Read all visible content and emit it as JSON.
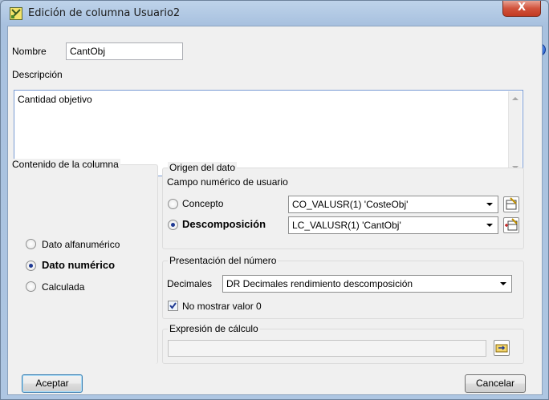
{
  "window": {
    "title": "Edición de columna Usuario2",
    "close_glyph": "X"
  },
  "nombre": {
    "label": "Nombre",
    "value": "CantObj"
  },
  "descripcion": {
    "label": "Descripción",
    "value": "Cantidad objetivo"
  },
  "help_glyph": "?",
  "contenido": {
    "title": "Contenido de la columna",
    "options": [
      {
        "label": "Dato alfanumérico",
        "selected": false
      },
      {
        "label": "Dato numérico",
        "selected": true
      },
      {
        "label": "Calculada",
        "selected": false
      }
    ]
  },
  "origen": {
    "title": "Origen del dato",
    "subtitle": "Campo numérico de usuario",
    "concepto": {
      "label": "Concepto",
      "selected": false,
      "value": "CO_VALUSR(1) 'CosteObj'"
    },
    "descomposicion": {
      "label": "Descomposición",
      "selected": true,
      "value": "LC_VALUSR(1) 'CantObj'"
    }
  },
  "presentacion": {
    "title": "Presentación del número",
    "decimales_label": "Decimales",
    "decimales_value": "DR Decimales rendimiento descomposición",
    "no_mostrar_label": "No mostrar valor 0",
    "no_mostrar_checked": true
  },
  "expresion": {
    "title": "Expresión de cálculo",
    "value": ""
  },
  "buttons": {
    "accept": "Aceptar",
    "cancel": "Cancelar"
  },
  "icons": {
    "app": "table-edit-icon",
    "field_picker": "field-picker-icon",
    "field_picker_add": "field-picker-add-icon",
    "expression": "expression-editor-icon",
    "help": "help-icon"
  }
}
